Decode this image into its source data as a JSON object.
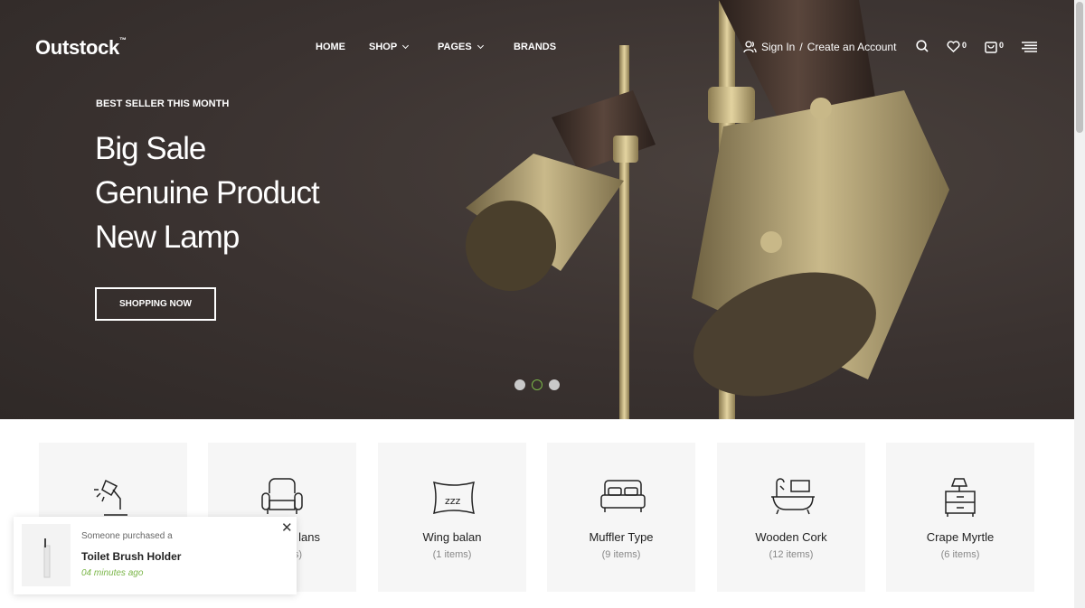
{
  "brand": {
    "logo": "Outstock",
    "tm": "™"
  },
  "nav": [
    {
      "label": "HOME"
    },
    {
      "label": "SHOP",
      "dropdown": true
    },
    {
      "label": "PAGES",
      "dropdown": true
    },
    {
      "label": "BRANDS"
    }
  ],
  "account": {
    "sign_in": "Sign In",
    "sep": "/",
    "create": "Create an Account",
    "icon": "user-icon"
  },
  "header_icons": {
    "search": "search-icon",
    "wishlist": "heart-icon",
    "wishlist_count": "0",
    "cart": "bag-icon",
    "cart_count": "0",
    "menu": "menu-icon"
  },
  "hero": {
    "eyebrow": "BEST SELLER THIS MONTH",
    "lines": [
      "Big Sale",
      "Genuine Product",
      "New Lamp"
    ],
    "cta": "SHOPPING NOW",
    "slides": 3,
    "active_slide": 2
  },
  "colors": {
    "accent": "#7ab648",
    "hero_bg": "#3a3230",
    "card_bg": "#f6f6f6"
  },
  "categories": [
    {
      "name": "",
      "count": "",
      "icon": "desk-lamp-icon"
    },
    {
      "name": "lans",
      "count": "s)",
      "icon": "armchair-icon"
    },
    {
      "name": "Wing balan",
      "count": "(1 items)",
      "icon": "pillow-icon"
    },
    {
      "name": "Muffler Type",
      "count": "(9 items)",
      "icon": "bed-icon"
    },
    {
      "name": "Wooden Cork",
      "count": "(12 items)",
      "icon": "bathtub-icon"
    },
    {
      "name": "Crape Myrtle",
      "count": "(6 items)",
      "icon": "nightstand-icon"
    }
  ],
  "popup": {
    "line1": "Someone purchased a",
    "product": "Toilet Brush Holder",
    "time": "04 minutes ago"
  }
}
